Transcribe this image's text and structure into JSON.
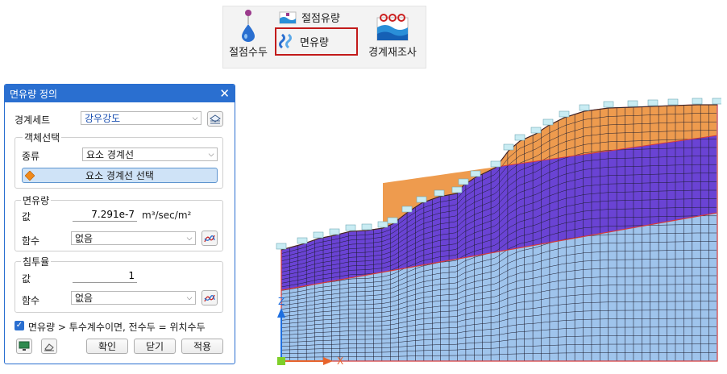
{
  "ribbon": {
    "node_head_label": "절점수두",
    "node_flow_label": "절점유량",
    "surface_flow_label": "면유량",
    "boundary_review_label": "경계재조사"
  },
  "dialog": {
    "title": "면유량 정의",
    "boundary_set": {
      "label": "경계세트",
      "value": "강우강도"
    },
    "object_select": {
      "group_title": "객체선택",
      "type_label": "종류",
      "type_value": "요소 경계선",
      "select_button": "요소 경계선 선택"
    },
    "surface_flow": {
      "group_title": "면유량",
      "value_label": "값",
      "value": "7.291e-7",
      "unit": "m³/sec/m²",
      "function_label": "함수",
      "function_value": "없음"
    },
    "infiltration": {
      "group_title": "침투율",
      "value_label": "값",
      "value": "1",
      "function_label": "함수",
      "function_value": "없음"
    },
    "checkbox": {
      "checked": true,
      "label": "면유량 > 투수계수이면, 전수두 = 위치수두"
    },
    "buttons": {
      "ok": "확인",
      "close": "닫기",
      "apply": "적용"
    }
  },
  "axes": {
    "z": "Z",
    "x": "X"
  },
  "colors": {
    "title_bar": "#2a6fd0",
    "layer_top": "#ee9b4e",
    "layer_middle": "#6a43d4",
    "layer_bottom": "#9fc4ec",
    "boundary_line": "#d63a3a",
    "highlight": "#c21a1a"
  }
}
